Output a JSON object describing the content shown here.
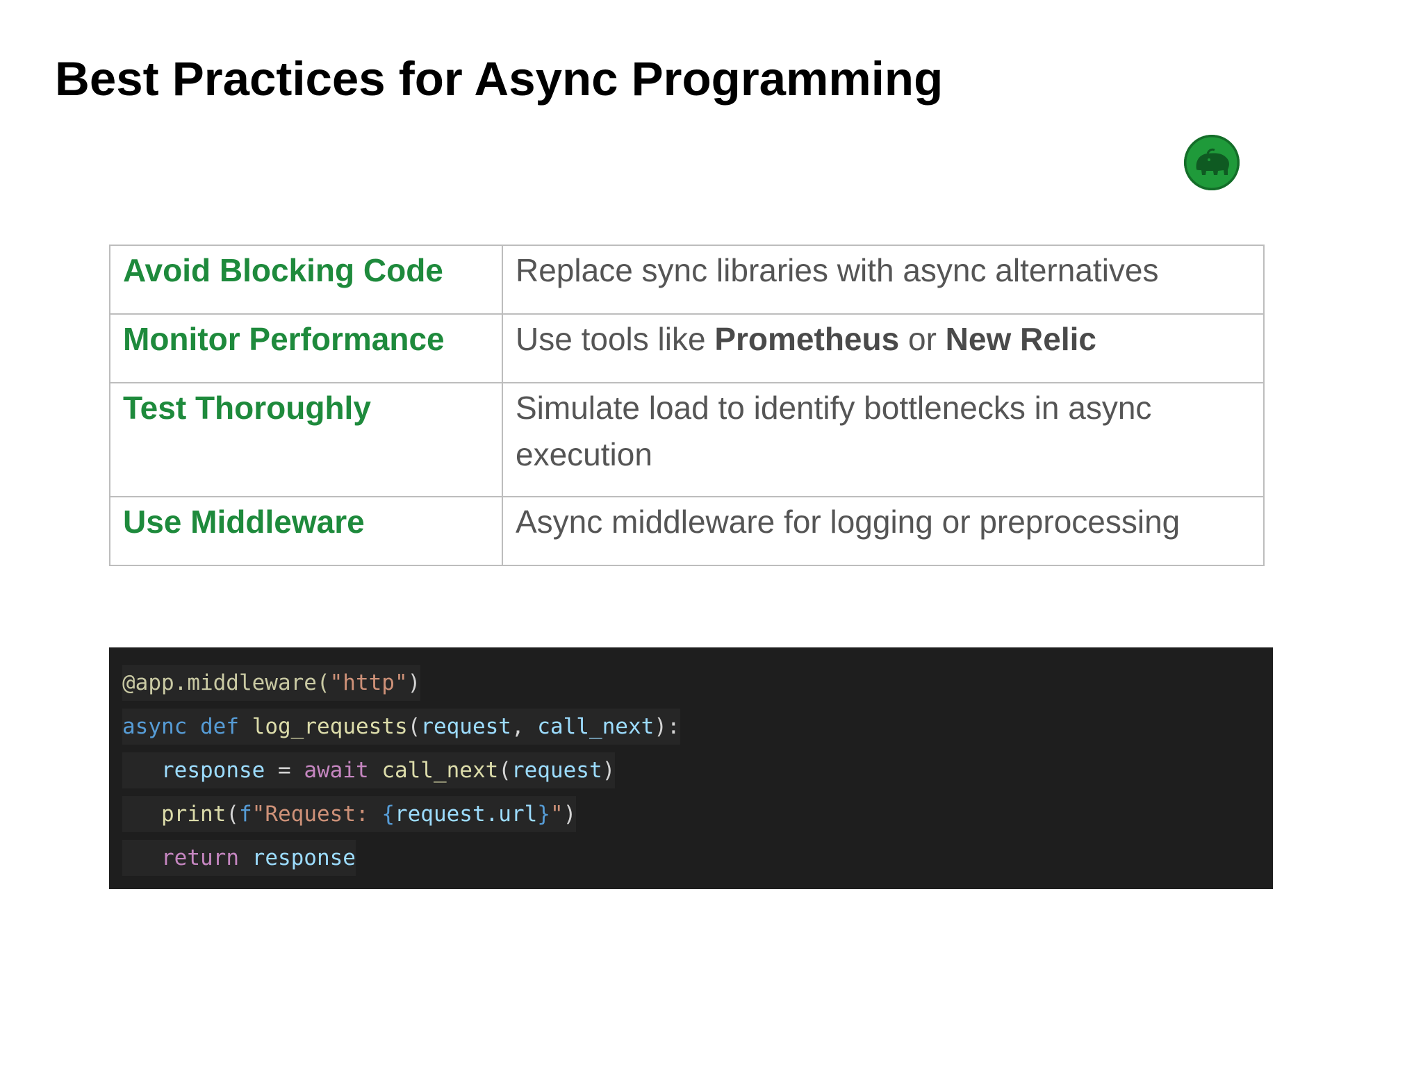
{
  "page": {
    "title": "Best Practices for Async Programming"
  },
  "logo": {
    "icon": "elephant-icon",
    "color": "#1f9a3a"
  },
  "practices": [
    {
      "name": "Avoid Blocking Code",
      "description": "Replace sync libraries with async alternatives"
    },
    {
      "name": "Monitor Performance",
      "description_prefix": "Use tools like ",
      "tool_1": "Prometheus",
      "description_middle": " or ",
      "tool_2": "New Relic"
    },
    {
      "name": "Test Thoroughly",
      "description": "Simulate load to identify bottlenecks in async execution"
    },
    {
      "name": "Use Middleware",
      "description": "Async middleware for logging or preprocessing"
    }
  ],
  "code": {
    "line1": {
      "decorator": "@app.middleware(",
      "arg": "\"http\"",
      "close": ")"
    },
    "line2": {
      "kw1": "async",
      "kw2": "def",
      "fn": "log_requests",
      "open": "(",
      "p1": "request",
      "comma": ", ",
      "p2": "call_next",
      "close": "):"
    },
    "line3": {
      "indent": "   ",
      "var": "response",
      "eq": " = ",
      "kw": "await",
      "fn": "call_next",
      "open": "(",
      "arg": "request",
      "close": ")"
    },
    "line4": {
      "indent": "   ",
      "fn": "print",
      "open": "(",
      "prefix": "f",
      "str_start": "\"Request: ",
      "brace_open": "{",
      "expr": "request.url",
      "brace_close": "}",
      "str_end": "\"",
      "close": ")"
    },
    "line5": {
      "indent": "   ",
      "kw": "return",
      "var": "response"
    }
  },
  "colors": {
    "accent_green": "#1e8a3c",
    "code_background": "#1e1e1e"
  }
}
